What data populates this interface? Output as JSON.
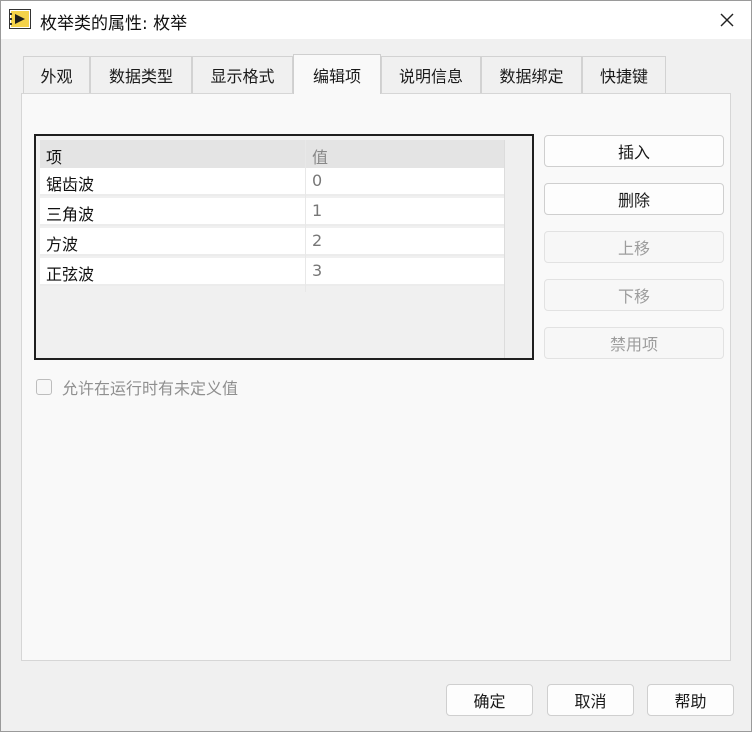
{
  "window": {
    "title": "枚举类的属性: 枚举"
  },
  "tabs": [
    {
      "label": "外观"
    },
    {
      "label": "数据类型"
    },
    {
      "label": "显示格式"
    },
    {
      "label": "编辑项"
    },
    {
      "label": "说明信息"
    },
    {
      "label": "数据绑定"
    },
    {
      "label": "快捷键"
    }
  ],
  "active_tab": "编辑项",
  "items_table": {
    "headers": {
      "item": "项",
      "value": "值"
    },
    "rows": [
      {
        "item": "锯齿波",
        "value": "0"
      },
      {
        "item": "三角波",
        "value": "1"
      },
      {
        "item": "方波",
        "value": "2"
      },
      {
        "item": "正弦波",
        "value": "3"
      }
    ]
  },
  "side_buttons": {
    "insert": "插入",
    "delete": "删除",
    "move_up": "上移",
    "move_down": "下移",
    "disable_item": "禁用项"
  },
  "undefined_values_checkbox": {
    "label": "允许在运行时有未定义值",
    "checked": false,
    "enabled": false
  },
  "footer": {
    "ok": "确定",
    "cancel": "取消",
    "help": "帮助"
  },
  "icons": {
    "app": "labview-vi-icon",
    "close": "close-icon"
  }
}
